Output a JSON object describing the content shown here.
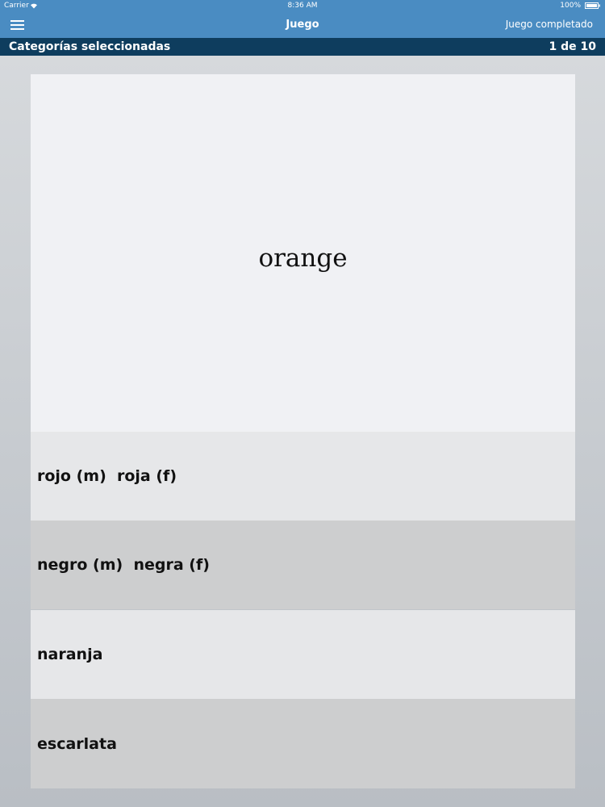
{
  "status_bar": {
    "carrier": "Carrier",
    "time": "8:36 AM",
    "battery": "100%"
  },
  "nav": {
    "title": "Juego",
    "right_button": "Juego completado",
    "menu_icon": "hamburger-menu-icon"
  },
  "category_bar": {
    "label": "Categorías seleccionadas",
    "progress": "1 de 10"
  },
  "question": {
    "word": "orange"
  },
  "answers": [
    {
      "text": "rojo (m)  roja (f)"
    },
    {
      "text": "negro (m)  negra (f)"
    },
    {
      "text": "naranja"
    },
    {
      "text": "escarlata"
    }
  ],
  "colors": {
    "nav_background": "#4a8cc2",
    "category_background": "#0e3d5e",
    "answer_light": "#e6e7e9",
    "answer_dark": "#cdcecf"
  }
}
